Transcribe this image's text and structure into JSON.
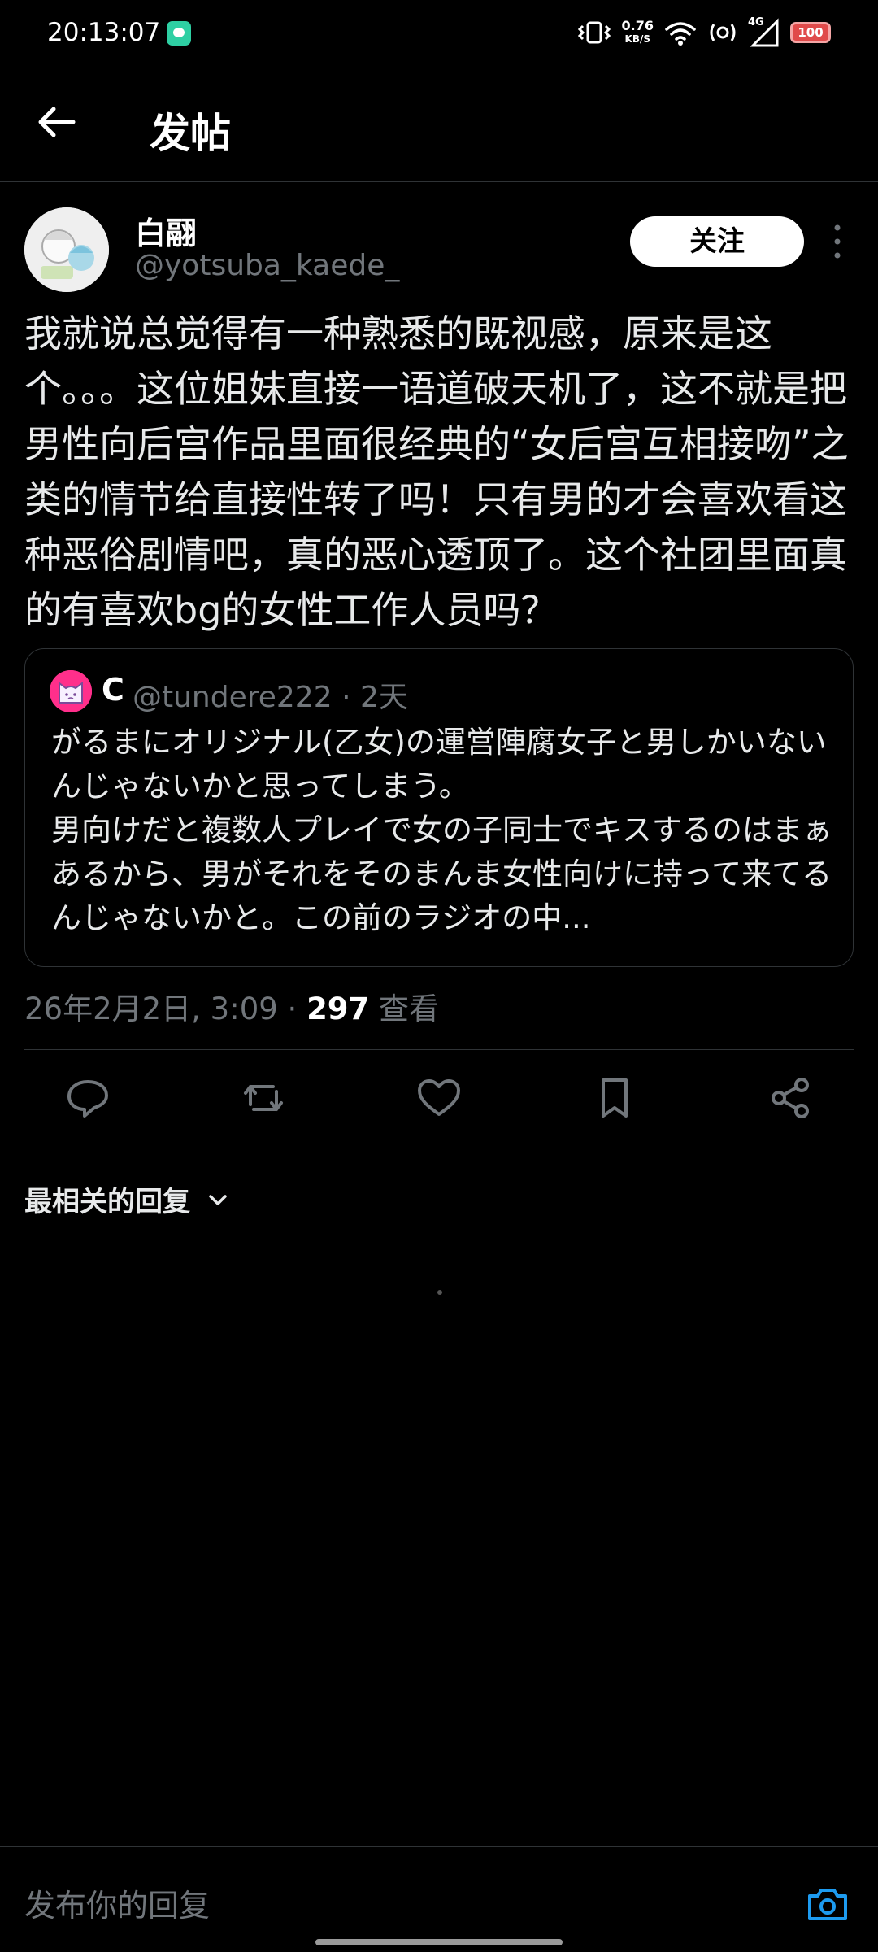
{
  "status_bar": {
    "time": "20:13:07",
    "net_speed_value": "0.76",
    "net_speed_unit": "KB/S",
    "network_type": "4G",
    "battery": "100"
  },
  "header": {
    "title": "发帖"
  },
  "post": {
    "author_name": "白翮",
    "author_handle": "@yotsuba_kaede_",
    "follow_label": "关注",
    "text": "我就说总觉得有一种熟悉的既视感，原来是这个。。。这位姐妹直接一语道破天机了，这不就是把男性向后宫作品里面很经典的“女后宫互相接吻”之类的情节给直接性转了吗！只有男的才会喜欢看这种恶俗剧情吧，真的恶心透顶了。这个社团里面真的有喜欢bg的女性工作人员吗？",
    "quote": {
      "author_name": "C",
      "meta": "@tundere222 · 2天",
      "text": "がるまにオリジナル(乙女)の運営陣腐女子と男しかいないんじゃないかと思ってしまう。\n男向けだと複数人プレイで女の子同士でキスするのはまぁあるから、男がそれをそのまんま女性向けに持って来てるんじゃないかと。この前のラジオの中..."
    },
    "timestamp": "26年2月2日, 3:09 · ",
    "views_count": "297",
    "views_label": " 查看"
  },
  "actions": [
    "reply-icon",
    "retweet-icon",
    "like-icon",
    "bookmark-icon",
    "share-icon"
  ],
  "replies": {
    "sort_label": "最相关的回复"
  },
  "composer": {
    "placeholder": "发布你的回复"
  },
  "colors": {
    "background": "#000000",
    "text": "#e7e9ea",
    "secondary_text": "#71767b",
    "divider": "#2f3336",
    "accent": "#1d9bf0"
  }
}
